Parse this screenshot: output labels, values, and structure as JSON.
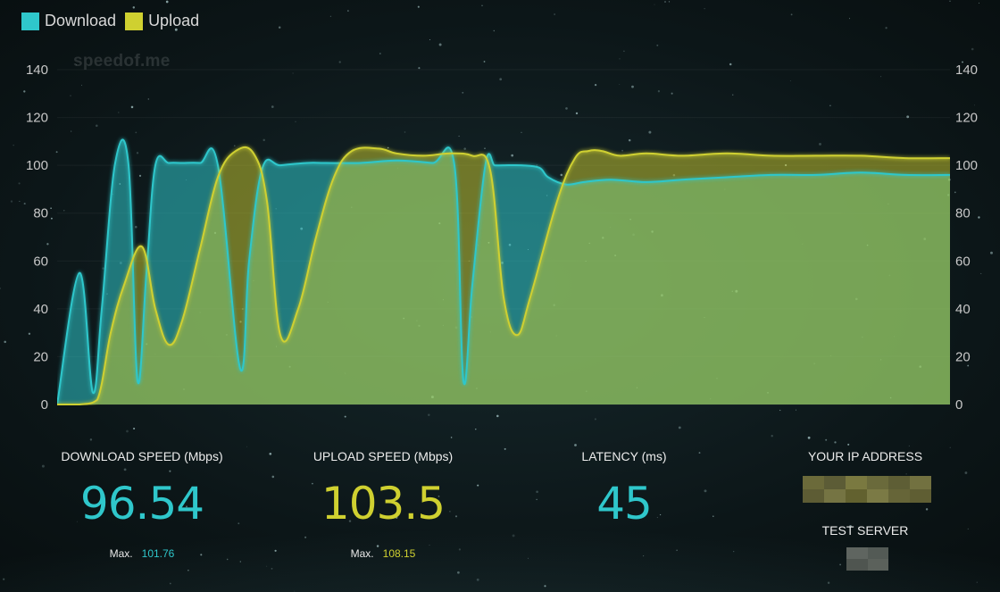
{
  "brand": {
    "watermark": "speedof.me"
  },
  "colors": {
    "download": "#2fc7cb",
    "upload": "#cfd030",
    "overlap": "#7aa34a"
  },
  "legend": [
    {
      "label": "Download",
      "color": "#2fc7cb"
    },
    {
      "label": "Upload",
      "color": "#cfd030"
    }
  ],
  "stats": {
    "download": {
      "label": "DOWNLOAD SPEED (Mbps)",
      "value": "96.54",
      "max_label": "Max.",
      "max_value": "101.76"
    },
    "upload": {
      "label": "UPLOAD SPEED (Mbps)",
      "value": "103.5",
      "max_label": "Max.",
      "max_value": "108.15"
    },
    "latency": {
      "label": "LATENCY (ms)",
      "value": "45"
    },
    "ip": {
      "label": "YOUR IP ADDRESS"
    },
    "server": {
      "label": "TEST SERVER"
    }
  },
  "chart_data": {
    "type": "area",
    "ylim": [
      0,
      140
    ],
    "yticks": [
      "0",
      "20",
      "40",
      "60",
      "80",
      "100",
      "120",
      "140"
    ],
    "series": [
      {
        "name": "Download",
        "x": [
          0,
          2.5,
          4,
          5,
          6.5,
          8,
          9,
          10,
          11,
          12.5,
          14,
          16,
          18,
          20.5,
          21.5,
          23,
          25,
          28,
          30,
          34,
          38,
          42,
          44.5,
          45.5,
          46.5,
          48,
          49,
          50,
          52,
          54,
          55,
          57,
          59,
          62,
          66,
          70,
          75,
          80,
          85,
          90,
          95,
          100
        ],
        "values": [
          0,
          55,
          5,
          40,
          101,
          100,
          10,
          55,
          100,
          101,
          101,
          101,
          100,
          15,
          60,
          99,
          100,
          101,
          101,
          101,
          102,
          101,
          100,
          10,
          50,
          101,
          100,
          100,
          100,
          99,
          95,
          92,
          93,
          94,
          93,
          94,
          95,
          96,
          96,
          97,
          96,
          96
        ]
      },
      {
        "name": "Upload",
        "x": [
          0,
          2.5,
          4.5,
          6,
          7.5,
          9.5,
          11,
          12.5,
          14,
          16,
          18,
          20,
          22,
          23.5,
          25,
          27,
          29,
          31,
          33,
          36,
          38,
          41,
          44,
          46.5,
          48.5,
          50,
          51.5,
          53,
          56,
          58,
          59.5,
          61,
          63,
          66,
          70,
          75,
          80,
          85,
          90,
          95,
          100
        ],
        "values": [
          0,
          0,
          2,
          30,
          50,
          66,
          40,
          25,
          35,
          65,
          95,
          106,
          105,
          85,
          29,
          40,
          70,
          95,
          106,
          107,
          105,
          104,
          105,
          104,
          98,
          45,
          29,
          45,
          85,
          103,
          106,
          106,
          104,
          105,
          104,
          105,
          104,
          104,
          104,
          103,
          103
        ]
      }
    ]
  }
}
